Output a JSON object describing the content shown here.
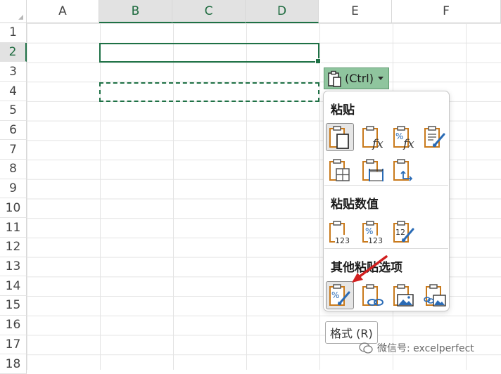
{
  "columns": [
    "A",
    "B",
    "C",
    "D",
    "E",
    "F"
  ],
  "rows": [
    "1",
    "2",
    "3",
    "4",
    "5",
    "6",
    "7",
    "8",
    "9",
    "10",
    "11",
    "12",
    "13",
    "14",
    "15",
    "16",
    "17",
    "18"
  ],
  "selected_columns": [
    "B",
    "C",
    "D"
  ],
  "selected_row": "2",
  "paste_button": {
    "label": "(Ctrl)",
    "icon": "clipboard-icon"
  },
  "paste_menu": {
    "section_paste": {
      "title": "粘贴",
      "options": [
        {
          "icon": "paste-icon",
          "selected": true
        },
        {
          "icon": "paste-formulas-icon"
        },
        {
          "icon": "paste-formulas-number-format-icon"
        },
        {
          "icon": "keep-source-formatting-icon"
        },
        {
          "icon": "no-borders-icon"
        },
        {
          "icon": "keep-column-widths-icon"
        },
        {
          "icon": "transpose-icon"
        }
      ]
    },
    "section_values": {
      "title": "粘贴数值",
      "options": [
        {
          "icon": "values-icon"
        },
        {
          "icon": "values-number-format-icon"
        },
        {
          "icon": "values-source-formatting-icon"
        }
      ]
    },
    "section_other": {
      "title": "其他粘贴选项",
      "options": [
        {
          "icon": "formatting-icon",
          "selected": true
        },
        {
          "icon": "paste-link-icon"
        },
        {
          "icon": "picture-icon"
        },
        {
          "icon": "linked-picture-icon"
        }
      ]
    }
  },
  "tooltip": "格式 (R)",
  "watermark": "微信号: excelperfect",
  "colors": {
    "accent": "#1e7145",
    "paste_button_bg": "#8fc59e",
    "clipboard_orange": "#c97a1c",
    "arrow": "#d11f1f"
  }
}
